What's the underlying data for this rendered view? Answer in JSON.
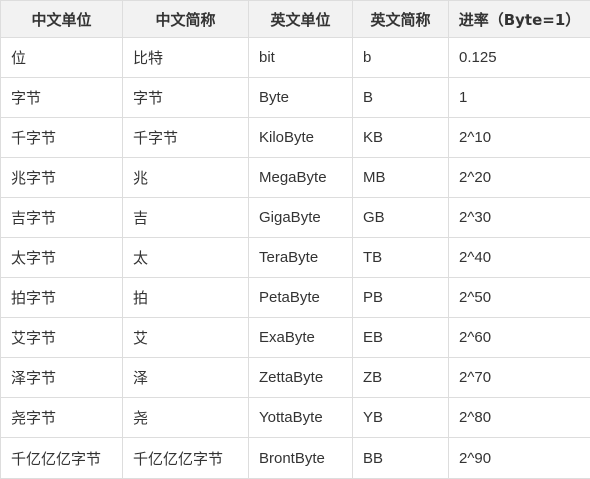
{
  "headers": [
    "中文单位",
    "中文简称",
    "英文单位",
    "英文简称",
    "进率（Byte=1）"
  ],
  "rows": [
    [
      "位",
      "比特",
      "bit",
      "b",
      "0.125"
    ],
    [
      "字节",
      "字节",
      "Byte",
      "B",
      "1"
    ],
    [
      "千字节",
      "千字节",
      "KiloByte",
      "KB",
      "2^10"
    ],
    [
      "兆字节",
      "兆",
      "MegaByte",
      "MB",
      "2^20"
    ],
    [
      "吉字节",
      "吉",
      "GigaByte",
      "GB",
      "2^30"
    ],
    [
      "太字节",
      "太",
      "TeraByte",
      "TB",
      "2^40"
    ],
    [
      "拍字节",
      "拍",
      "PetaByte",
      "PB",
      "2^50"
    ],
    [
      "艾字节",
      "艾",
      "ExaByte",
      "EB",
      "2^60"
    ],
    [
      "泽字节",
      "泽",
      "ZettaByte",
      "ZB",
      "2^70"
    ],
    [
      "尧字节",
      "尧",
      "YottaByte",
      "YB",
      "2^80"
    ],
    [
      "千亿亿亿字节",
      "千亿亿亿字节",
      "BrontByte",
      "BB",
      "2^90"
    ]
  ]
}
